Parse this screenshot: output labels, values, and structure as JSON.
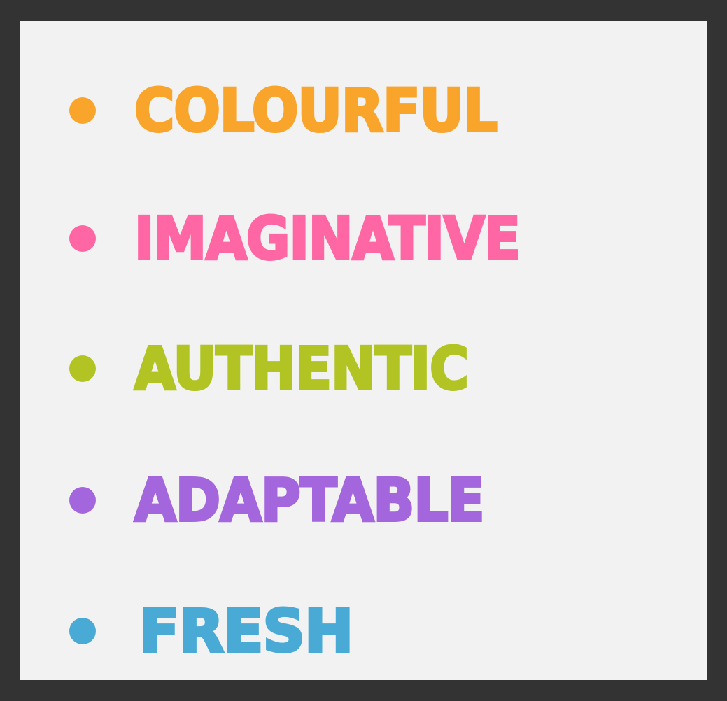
{
  "items": [
    {
      "label": "COLOURFUL",
      "color": "#f9a52c"
    },
    {
      "label": "IMAGINATIVE",
      "color": "#ff66a4"
    },
    {
      "label": "AUTHENTIC",
      "color": "#b1c423"
    },
    {
      "label": "ADAPTABLE",
      "color": "#a466dc"
    },
    {
      "label": "FRESH",
      "color": "#4aaad6"
    }
  ],
  "colors": {
    "frame": "#333333",
    "panel": "#f2f2f2"
  }
}
